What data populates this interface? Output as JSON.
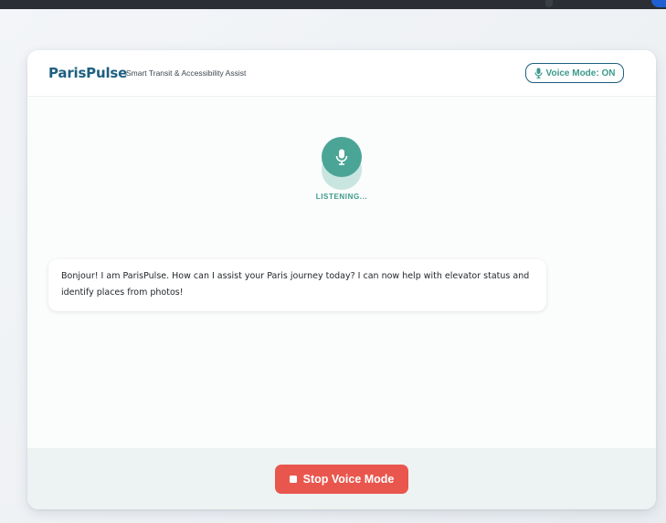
{
  "app": {
    "brand": "ParisPulse",
    "tagline": "Smart Transit & Accessibility Assist"
  },
  "voice_badge": {
    "label": "Voice Mode: ON",
    "icon": "microphone-icon"
  },
  "mic": {
    "icon": "microphone-icon",
    "status": "LISTENING..."
  },
  "messages": [
    {
      "role": "assistant",
      "text": "Bonjour! I am ParisPulse. How can I assist your Paris journey today? I can now help with elevator status and identify places from photos!"
    }
  ],
  "footer": {
    "stop_label": "Stop Voice Mode",
    "stop_icon": "stop-square-icon"
  },
  "colors": {
    "brand": "#1e5f80",
    "accent": "#4aa597",
    "danger": "#e9564d"
  }
}
